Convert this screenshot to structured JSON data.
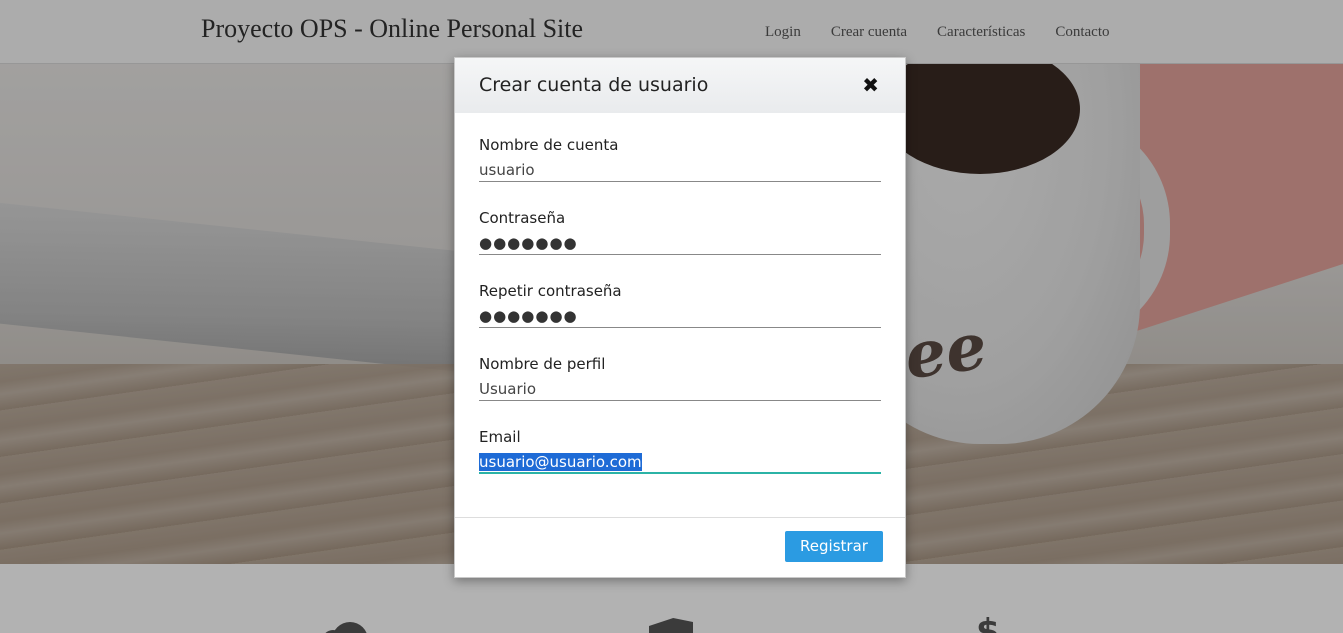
{
  "navbar": {
    "brand": "Proyecto OPS - Online Personal Site",
    "links": [
      "Login",
      "Crear cuenta",
      "Características",
      "Contacto"
    ]
  },
  "hero": {
    "cup_text": "ee"
  },
  "features": {
    "icons": [
      "cloud-icon",
      "building-icon",
      "dollar-icon"
    ],
    "dollar_glyph": "$"
  },
  "modal": {
    "title": "Crear cuenta de usuario",
    "close_glyph": "✖",
    "fields": [
      {
        "label": "Nombre de cuenta",
        "value": "usuario"
      },
      {
        "label": "Contraseña",
        "value": "●●●●●●●"
      },
      {
        "label": "Repetir contraseña",
        "value": "●●●●●●●"
      },
      {
        "label": "Nombre de perfil",
        "value": "Usuario"
      },
      {
        "label": "Email",
        "value": "usuario@usuario.com"
      }
    ],
    "submit_label": "Registrar"
  },
  "colors": {
    "primary_button": "#2b9be2",
    "focus_underline": "#2bb3a6",
    "selection": "#1e6bd6"
  }
}
